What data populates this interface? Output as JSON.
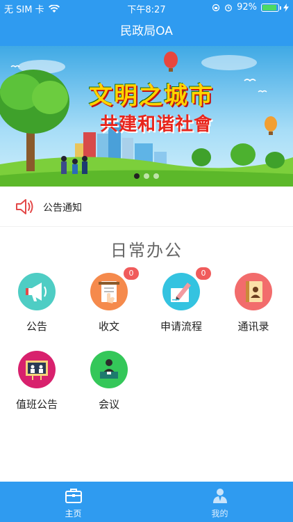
{
  "status_bar": {
    "carrier": "无 SIM 卡",
    "time": "下午8:27",
    "battery": "92%",
    "battery_level": 0.92
  },
  "header": {
    "title": "民政局OA"
  },
  "banner": {
    "line1": "文明之城市",
    "line2": "共建和谐社會",
    "slide_count": 3,
    "active_slide": 1
  },
  "notice": {
    "label": "公告通知",
    "icon": "speaker-icon"
  },
  "section": {
    "title": "日常办公"
  },
  "grid": [
    {
      "label": "公告",
      "icon": "megaphone-icon",
      "color": "#4ecdc4",
      "badge": ""
    },
    {
      "label": "收文",
      "icon": "document-hand-icon",
      "color": "#f58a4c",
      "badge": "0"
    },
    {
      "label": "申请流程",
      "icon": "pencil-paper-icon",
      "color": "#34c3e0",
      "badge": "0"
    },
    {
      "label": "通讯录",
      "icon": "contact-book-icon",
      "color": "#f26c6c",
      "badge": ""
    },
    {
      "label": "值班公告",
      "icon": "presentation-board-icon",
      "color": "#d8216d",
      "badge": ""
    },
    {
      "label": "会议",
      "icon": "meeting-icon",
      "color": "#34c759",
      "badge": ""
    }
  ],
  "tabbar": {
    "home": {
      "label": "主页",
      "icon": "briefcase-icon"
    },
    "mine": {
      "label": "我的",
      "icon": "person-icon"
    },
    "color": "#2f9bf0"
  }
}
